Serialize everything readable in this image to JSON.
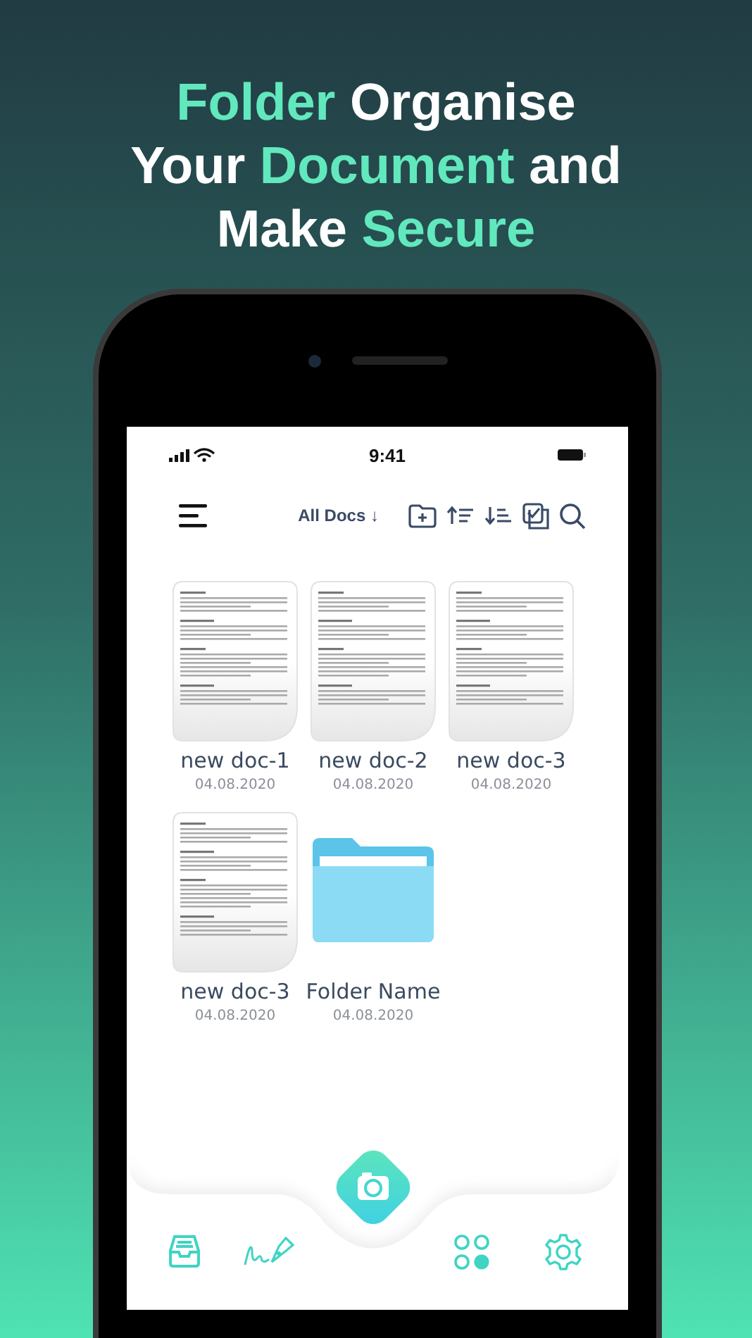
{
  "headline": {
    "lines": [
      [
        {
          "text": "Folder",
          "highlight": true
        },
        {
          "text": " Organise",
          "highlight": false
        }
      ],
      [
        {
          "text": "Your ",
          "highlight": false
        },
        {
          "text": "Document",
          "highlight": true
        },
        {
          "text": " and",
          "highlight": false
        }
      ],
      [
        {
          "text": "Make ",
          "highlight": false
        },
        {
          "text": "Secure",
          "highlight": true
        }
      ]
    ]
  },
  "status_bar": {
    "time": "9:41"
  },
  "toolbar": {
    "filter": "All Docs ↓"
  },
  "items": [
    {
      "kind": "document",
      "name": "new doc-1",
      "date": "04.08.2020"
    },
    {
      "kind": "document",
      "name": "new doc-2",
      "date": "04.08.2020"
    },
    {
      "kind": "document",
      "name": "new doc-3",
      "date": "04.08.2020"
    },
    {
      "kind": "document",
      "name": "new doc-3",
      "date": "04.08.2020"
    },
    {
      "kind": "folder",
      "name": "Folder Name",
      "date": "04.08.2020"
    }
  ]
}
